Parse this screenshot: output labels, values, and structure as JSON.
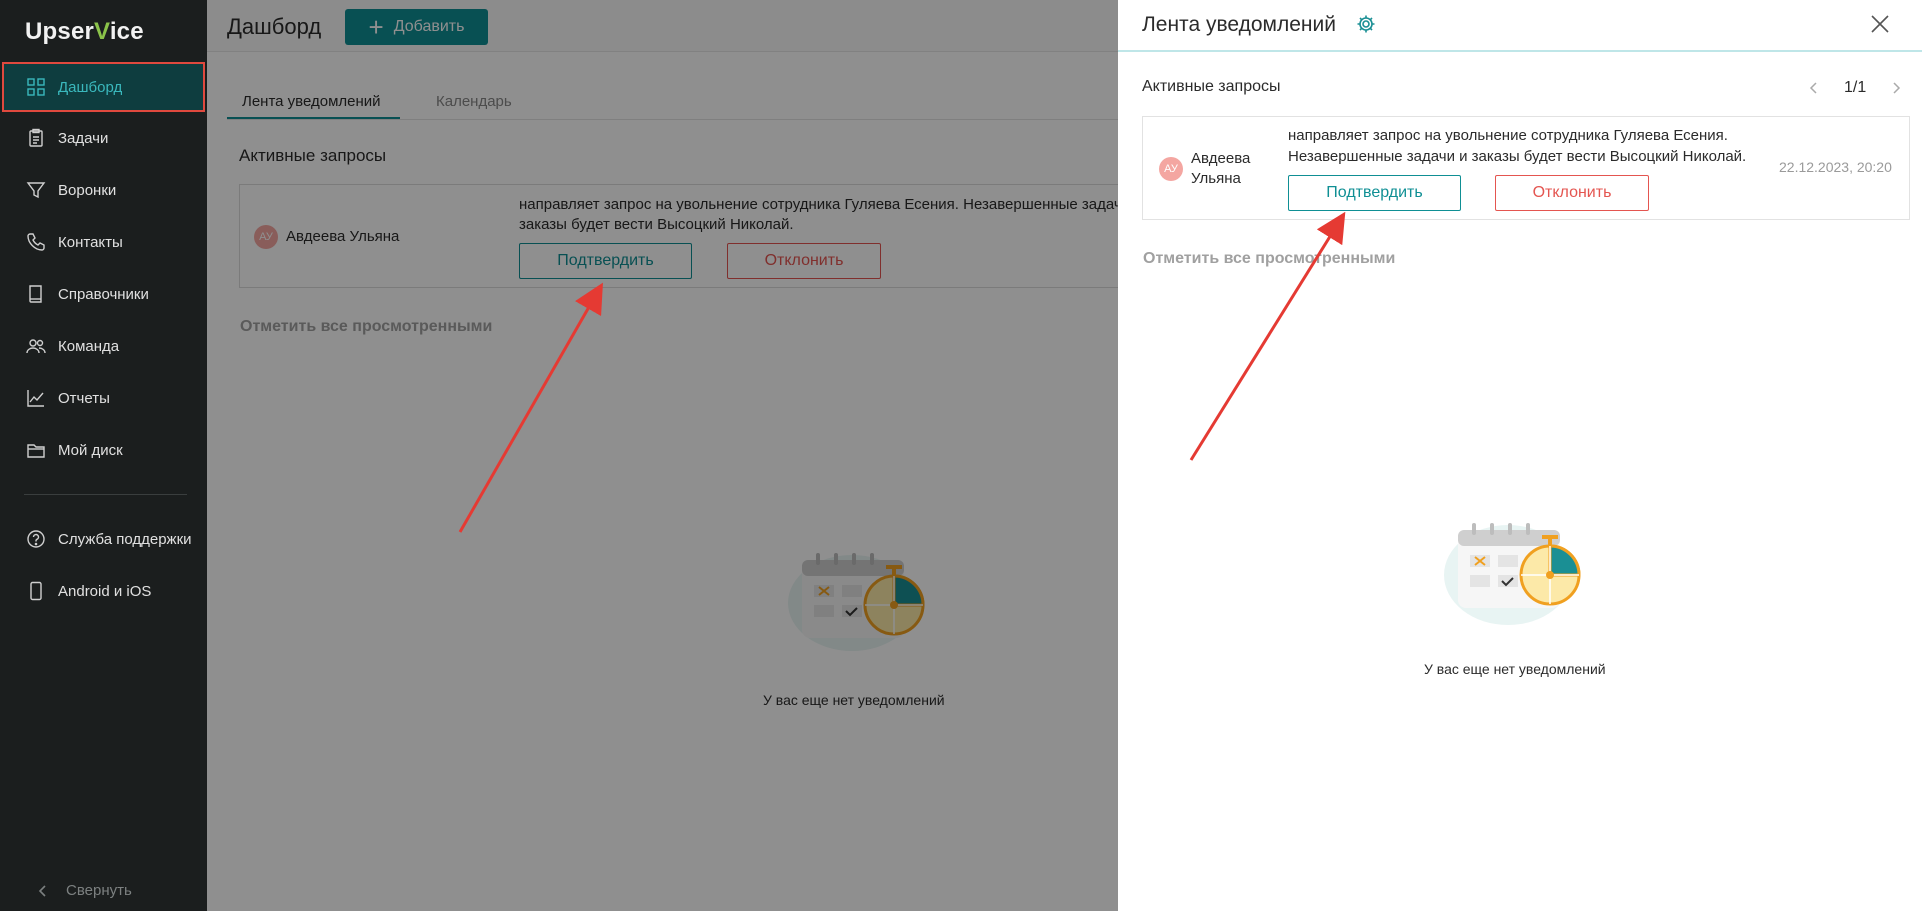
{
  "app": {
    "logo_left": "Upser",
    "logo_v": "V",
    "logo_right": "ice"
  },
  "sidebar": {
    "items": [
      {
        "label": "Дашборд",
        "icon": "dashboard-icon"
      },
      {
        "label": "Задачи",
        "icon": "tasks-icon"
      },
      {
        "label": "Воронки",
        "icon": "funnel-icon"
      },
      {
        "label": "Контакты",
        "icon": "phone-icon"
      },
      {
        "label": "Справочники",
        "icon": "book-icon"
      },
      {
        "label": "Команда",
        "icon": "team-icon"
      },
      {
        "label": "Отчеты",
        "icon": "chart-icon"
      },
      {
        "label": "Мой диск",
        "icon": "folder-icon"
      }
    ],
    "support": "Служба поддержки",
    "mobile": "Android и iOS",
    "collapse": "Свернуть"
  },
  "main": {
    "title": "Дашборд",
    "add_label": "Добавить",
    "tabs": [
      "Лента уведомлений",
      "Календарь"
    ],
    "section_title": "Активные запросы",
    "request": {
      "initials": "АУ",
      "name": "Авдеева Ульяна",
      "text": "направляет запрос на увольнение сотрудника Гуляева Есения. Незавершенные задачи и заказы будет вести Высоцкий Николай.",
      "confirm": "Подтвердить",
      "reject": "Отклонить"
    },
    "mark_all": "Отметить все просмотренными",
    "empty": "У вас еще нет уведомлений"
  },
  "drawer": {
    "title": "Лента уведомлений",
    "section_title": "Активные запросы",
    "pager": "1/1",
    "request": {
      "initials": "АУ",
      "name": "Авдеева Ульяна",
      "text": "направляет запрос на увольнение сотрудника Гуляева Есения. Незавершенные задачи и заказы будет вести Высоцкий Николай.",
      "confirm": "Подтвердить",
      "reject": "Отклонить",
      "date": "22.12.2023, 20:20"
    },
    "mark_all": "Отметить все просмотренными",
    "empty": "У вас еще нет уведомлений"
  },
  "colors": {
    "accent": "#0f8f94",
    "danger": "#e45550",
    "sidebar": "#1b1e1e",
    "highlight": "#e0493e"
  }
}
